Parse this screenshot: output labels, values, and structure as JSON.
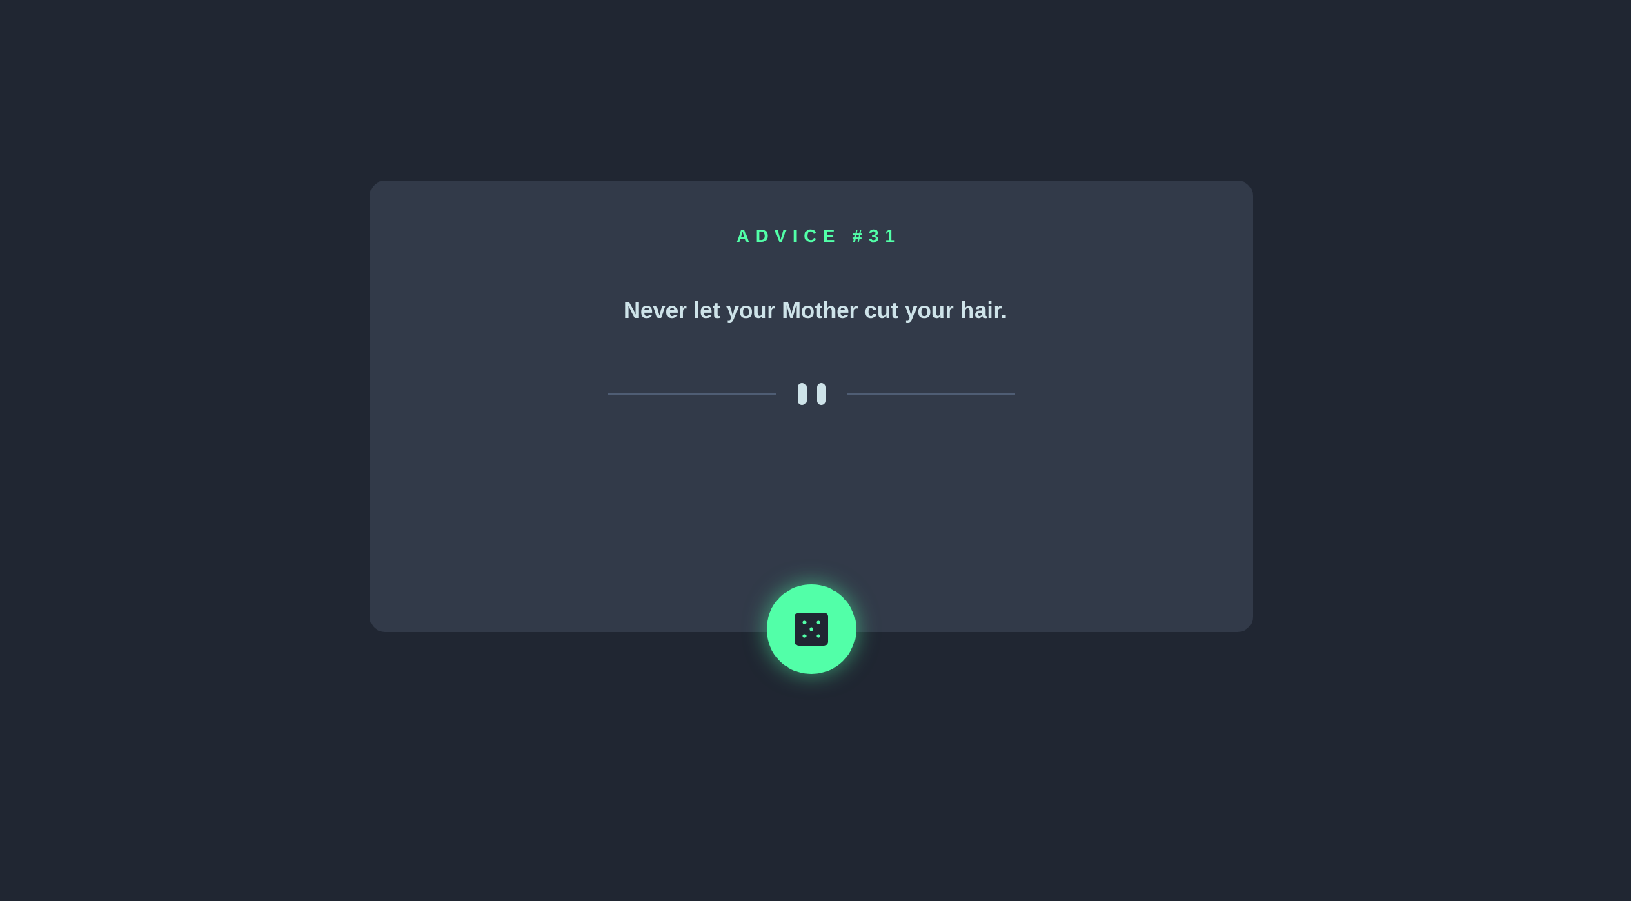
{
  "advice": {
    "label": "ADVICE #31",
    "quote": "Never let your Mother cut your hair."
  },
  "divider": {
    "icon": "pause-icon"
  },
  "dice_button": {
    "icon": "dice-icon"
  },
  "colors": {
    "background": "#202632",
    "card": "#323a49",
    "accent": "#52ffa8",
    "text": "#cee3e9",
    "divider": "#4f5d74"
  }
}
